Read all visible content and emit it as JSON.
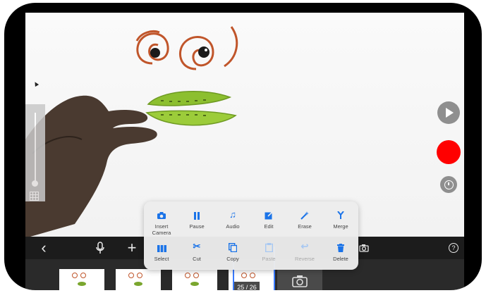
{
  "editor": {
    "counter": "25 / 26"
  },
  "controls": {
    "play_icon": "play-icon",
    "record_icon": "record-icon",
    "timer_icon": "timer-icon",
    "record_color": "#ff0000"
  },
  "toolbar": {
    "back_icon": "chevron-left-icon",
    "back_glyph": "‹",
    "mic_icon": "microphone-icon",
    "mic_glyph": "🎙",
    "add_icon": "plus-icon",
    "add_glyph": "+",
    "help_icon": "help-icon",
    "help_glyph": "?"
  },
  "menu": {
    "row1": [
      {
        "label": "Insert\nCamera",
        "icon": "camera-icon",
        "glyph": "◉",
        "enabled": true
      },
      {
        "label": "Pause",
        "icon": "pause-icon",
        "glyph": "❚❚",
        "enabled": true
      },
      {
        "label": "Audio",
        "icon": "music-note-icon",
        "glyph": "♫",
        "enabled": true
      },
      {
        "label": "Edit",
        "icon": "edit-icon",
        "glyph": "✎",
        "enabled": true
      },
      {
        "label": "Erase",
        "icon": "magic-wand-icon",
        "glyph": "⁂",
        "enabled": true
      },
      {
        "label": "Merge",
        "icon": "merge-icon",
        "glyph": "⅄",
        "enabled": true
      }
    ],
    "row2": [
      {
        "label": "Select",
        "icon": "select-frames-icon",
        "glyph": "▮▮▮",
        "enabled": true
      },
      {
        "label": "Cut",
        "icon": "scissors-icon",
        "glyph": "✂",
        "enabled": true
      },
      {
        "label": "Copy",
        "icon": "copy-icon",
        "glyph": "❐",
        "enabled": true
      },
      {
        "label": "Paste",
        "icon": "paste-icon",
        "glyph": "▤",
        "enabled": false
      },
      {
        "label": "Reverse",
        "icon": "reverse-icon",
        "glyph": "↩",
        "enabled": false
      },
      {
        "label": "Delete",
        "icon": "trash-icon",
        "glyph": "🗑",
        "enabled": true
      }
    ]
  },
  "filmstrip": {
    "camera_icon": "camera-icon"
  }
}
